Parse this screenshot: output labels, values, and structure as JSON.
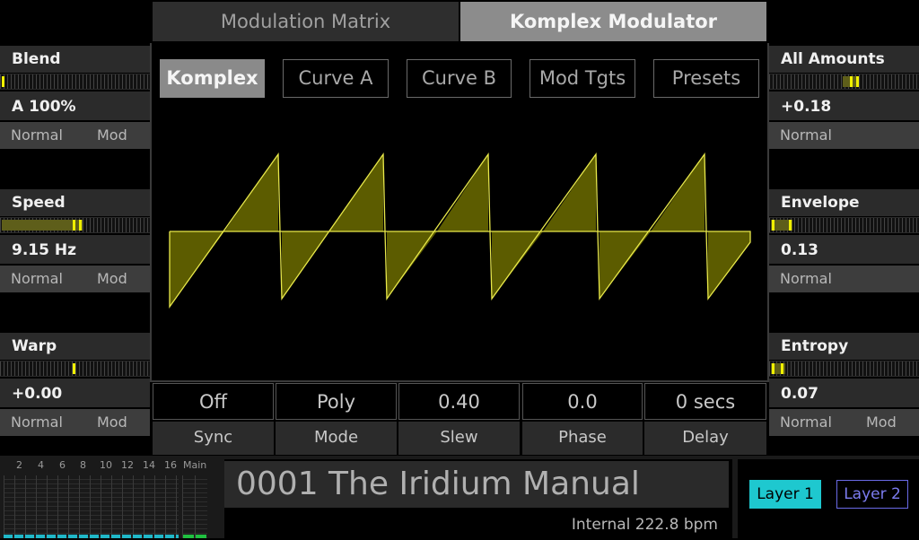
{
  "header": {
    "tabs": [
      {
        "label": "Modulation Matrix",
        "active": false
      },
      {
        "label": "Komplex Modulator",
        "active": true
      }
    ]
  },
  "subtabs": [
    {
      "label": "Komplex",
      "active": true
    },
    {
      "label": "Curve A",
      "active": false
    },
    {
      "label": "Curve B",
      "active": false
    },
    {
      "label": "Mod Tgts",
      "active": false
    },
    {
      "label": "Presets",
      "active": false
    }
  ],
  "left_params": [
    {
      "title": "Blend",
      "value": "A 100%",
      "mode_normal": "Normal",
      "mode_mod": "Mod",
      "level": 0.02
    },
    {
      "title": "Speed",
      "value": "9.15 Hz",
      "mode_normal": "Normal",
      "mode_mod": "Mod",
      "level": 0.55
    },
    {
      "title": "Warp",
      "value": "+0.00",
      "mode_normal": "Normal",
      "mode_mod": "Mod",
      "level": 0.5
    }
  ],
  "right_params": [
    {
      "title": "All Amounts",
      "value": "+0.18",
      "mode_normal": "Normal",
      "mode_mod": "",
      "level": 0.59
    },
    {
      "title": "Envelope",
      "value": "0.13",
      "mode_normal": "Normal",
      "mode_mod": "",
      "level": 0.13
    },
    {
      "title": "Entropy",
      "value": "0.07",
      "mode_normal": "Normal",
      "mode_mod": "Mod",
      "level": 0.07
    }
  ],
  "controls": [
    {
      "value": "Off",
      "label": "Sync"
    },
    {
      "value": "Poly",
      "label": "Mode"
    },
    {
      "value": "0.40",
      "label": "Slew"
    },
    {
      "value": "0.0",
      "label": "Phase"
    },
    {
      "value": "0 secs",
      "label": "Delay"
    }
  ],
  "mixer": {
    "labels": [
      "2",
      "4",
      "6",
      "8",
      "10",
      "12",
      "14",
      "16",
      "Main"
    ]
  },
  "patch": {
    "name": "0001 The Iridium Manual",
    "tempo": "Internal 222.8 bpm"
  },
  "layers": [
    "Layer 1",
    "Layer 2"
  ],
  "colors": {
    "waveform": "#e8e84a",
    "waveform_fill": "#5c5c00",
    "layer1_bg": "#1ec8cf",
    "layer2_border": "#6a6ae6",
    "meter_cyan": "#20b8c8",
    "meter_green": "#20c040"
  }
}
